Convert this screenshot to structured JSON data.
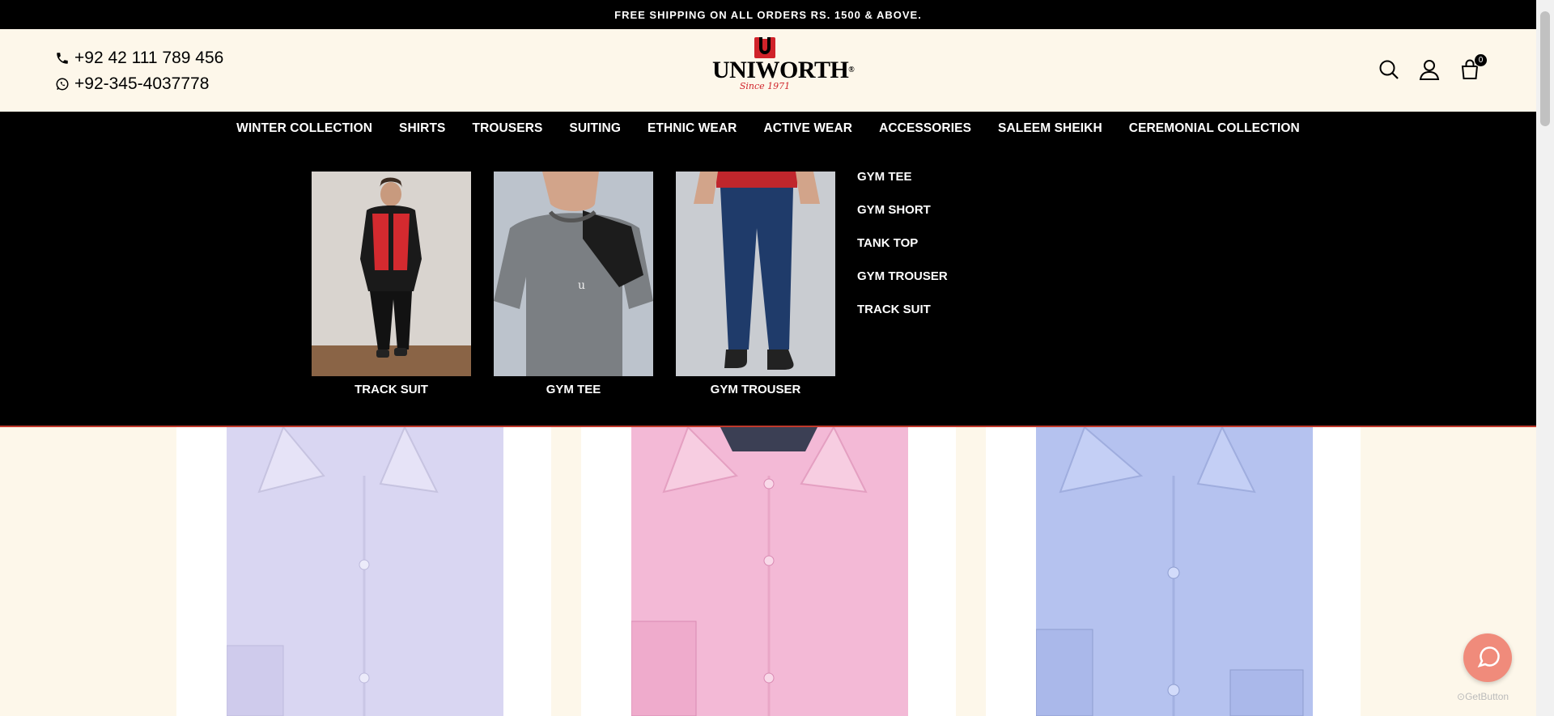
{
  "announcement": "FREE SHIPPING ON ALL ORDERS RS. 1500 & ABOVE.",
  "contact": {
    "phone": "+92 42 111 789 456",
    "whatsapp": "+92-345-4037778"
  },
  "logo": {
    "word": "UNIWORTH",
    "reg": "®",
    "since": "Since 1971"
  },
  "cart": {
    "count": "0"
  },
  "nav": {
    "items": [
      {
        "label": "WINTER COLLECTION"
      },
      {
        "label": "SHIRTS"
      },
      {
        "label": "TROUSERS"
      },
      {
        "label": "SUITING"
      },
      {
        "label": "ETHNIC WEAR"
      },
      {
        "label": "ACTIVE WEAR"
      },
      {
        "label": "ACCESSORIES"
      },
      {
        "label": "SALEEM SHEIKH"
      },
      {
        "label": "CEREMONIAL COLLECTION"
      }
    ]
  },
  "mega": {
    "cards": [
      {
        "caption": "TRACK SUIT"
      },
      {
        "caption": "GYM TEE"
      },
      {
        "caption": "GYM TROUSER"
      }
    ],
    "links": [
      {
        "label": "GYM TEE"
      },
      {
        "label": "GYM SHORT"
      },
      {
        "label": "TANK TOP"
      },
      {
        "label": "GYM TROUSER"
      },
      {
        "label": "TRACK SUIT"
      }
    ]
  },
  "products": [
    {
      "color": "#d9d6f2"
    },
    {
      "color": "#f3b9d6"
    },
    {
      "color": "#b5c2ef"
    }
  ],
  "chat": {
    "brand": "GetButton"
  },
  "colors": {
    "background": "#fdf7ea",
    "bar": "#000000",
    "brand_red": "#d0232a",
    "chat": "#f08b7b"
  }
}
